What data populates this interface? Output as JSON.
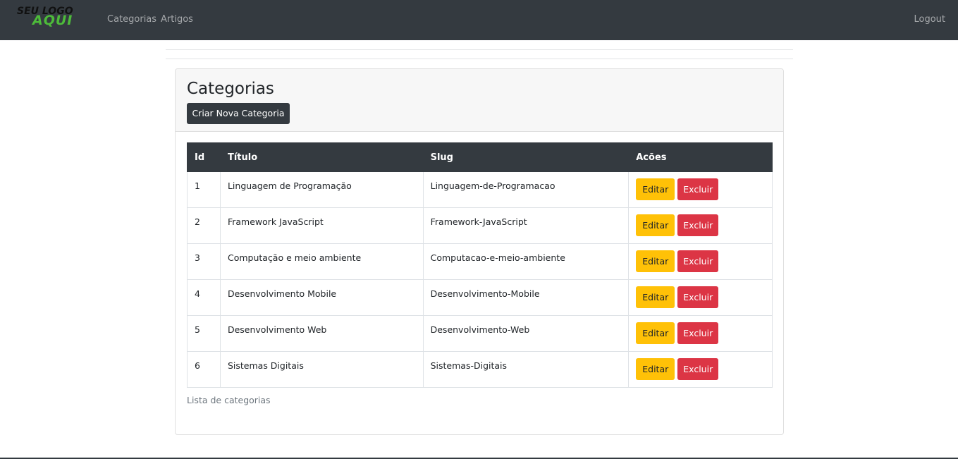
{
  "navbar": {
    "brand_line1": "SEU LOGO",
    "brand_line2": "AQUI",
    "links": [
      "Categorias",
      "Artigos"
    ],
    "logout": "Logout",
    "bg_color": "#343a40",
    "brand_color": "#4dbb3a"
  },
  "card": {
    "title": "Categorias",
    "new_button": "Criar Nova Categoria",
    "caption": "Lista de categorias"
  },
  "table": {
    "headers": [
      "Id",
      "Título",
      "Slug",
      "Acões"
    ],
    "rows": [
      {
        "id": "1",
        "titulo": "Linguagem de Programação",
        "slug": "Linguagem-de-Programacao",
        "edit": "Editar",
        "delete": "Excluir"
      },
      {
        "id": "2",
        "titulo": "Framework JavaScript",
        "slug": "Framework-JavaScript",
        "edit": "Editar",
        "delete": "Excluir"
      },
      {
        "id": "3",
        "titulo": "Computação e meio ambiente",
        "slug": "Computacao-e-meio-ambiente",
        "edit": "Editar",
        "delete": "Excluir"
      },
      {
        "id": "4",
        "titulo": "Desenvolvimento Mobile",
        "slug": "Desenvolvimento-Mobile",
        "edit": "Editar",
        "delete": "Excluir"
      },
      {
        "id": "5",
        "titulo": "Desenvolvimento Web",
        "slug": "Desenvolvimento-Web",
        "edit": "Editar",
        "delete": "Excluir"
      },
      {
        "id": "6",
        "titulo": "Sistemas Digitais",
        "slug": "Sistemas-Digitais",
        "edit": "Editar",
        "delete": "Excluir"
      }
    ],
    "edit_color": "#ffc107",
    "delete_color": "#dc3545"
  }
}
